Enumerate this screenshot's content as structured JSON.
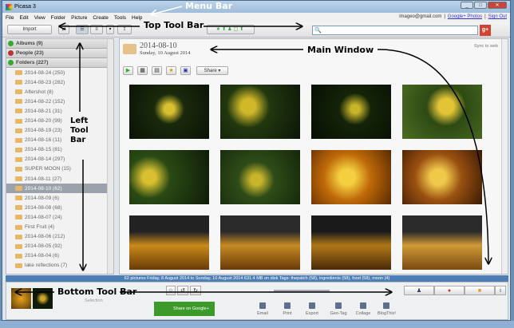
{
  "window": {
    "title": "Picasa 3"
  },
  "menu": [
    "File",
    "Edit",
    "View",
    "Folder",
    "Picture",
    "Create",
    "Tools",
    "Help"
  ],
  "account": {
    "email": "imageo@gmail.com",
    "photos_link": "Google+ Photos",
    "signout": "Sign Out"
  },
  "toolbar": {
    "import": "Import",
    "search_placeholder": ""
  },
  "left": {
    "sections": [
      {
        "label": "Albums (9)"
      },
      {
        "label": "People (23)"
      },
      {
        "label": "Folders (227)"
      }
    ],
    "folders": [
      "2014-08-24 (250)",
      "2014-08-23 (282)",
      "Aftershot (8)",
      "2014-08-22 (152)",
      "2014-08-21 (31)",
      "2014-08-20 (99)",
      "2014-08-19 (23)",
      "2014-08-16 (11)",
      "2014-08-15 (81)",
      "2014-08-14 (297)",
      "SUPER MOON (15)",
      "2014-08-11 (27)",
      "2014-08-10 (62)",
      "2014-08-09 (6)",
      "2014-08-08 (68)",
      "2014-08-07 (24)",
      "First Fruit (4)",
      "2014-08-06 (212)",
      "2014-08-05 (92)",
      "2014-08-04 (6)",
      "lake reflections (7)"
    ],
    "selected": "2014-08-10 (62)"
  },
  "main": {
    "title": "2014-08-10",
    "subtitle": "Sunday, 10 August 2014",
    "sync": "Sync to web",
    "share": "Share"
  },
  "status": "62 pictures    Friday, 8 August 2014 to Sunday, 10 August 2014    631.4 MB on disk    Tags: thepatch (58), ingredients (58), food (58), moon (4)",
  "bottom": {
    "selection": "Selection",
    "share_google": "Share on Google+",
    "actions": [
      "Email",
      "Print",
      "Export",
      "Geo-Tag",
      "Collage",
      "BlogThis!"
    ]
  },
  "annotations": {
    "menu_bar": "Menu Bar",
    "top_tool_bar": "Top Tool Bar",
    "main_window": "Main Window",
    "left_tool_bar": "Left\nTool\nBar",
    "bottom_tool_bar": "Bottom Tool Bar"
  }
}
